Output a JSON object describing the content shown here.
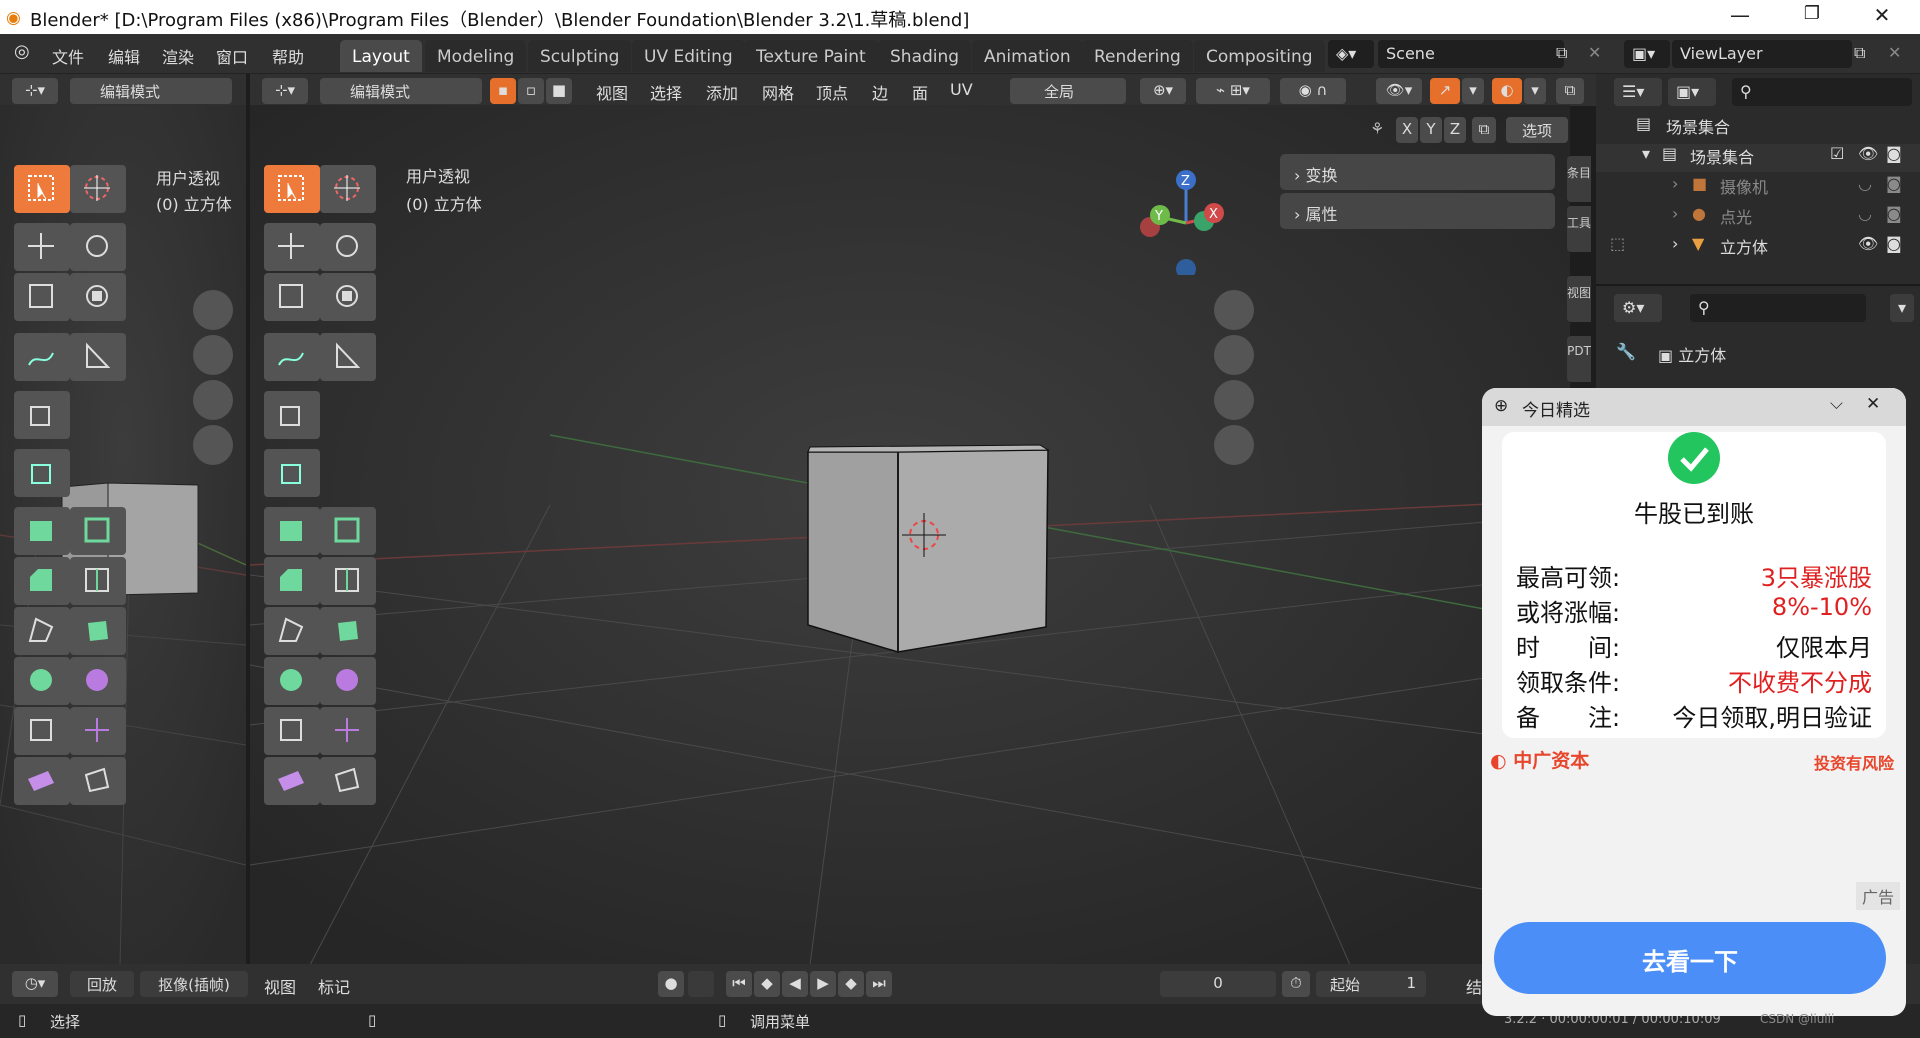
{
  "titlebar": {
    "title": "Blender* [D:\\Program Files (x86)\\Program Files（Blender）\\Blender Foundation\\Blender 3.2\\1.草稿.blend]",
    "minimize": "—",
    "restore": "❐",
    "close": "✕"
  },
  "menu": {
    "file": "文件",
    "edit": "编辑",
    "render": "渲染",
    "window": "窗口",
    "help": "帮助"
  },
  "workspace_tabs": [
    "Layout",
    "Modeling",
    "Sculpting",
    "UV Editing",
    "Texture Paint",
    "Shading",
    "Animation",
    "Rendering",
    "Compositing"
  ],
  "scene": {
    "name": "Scene",
    "viewlayer": "ViewLayer"
  },
  "left_view": {
    "mode": "编辑模式",
    "overlay_view": "用户透视",
    "overlay_obj": "(0) 立方体"
  },
  "main_view": {
    "mode": "编辑模式",
    "menus": [
      "视图",
      "选择",
      "添加",
      "网格",
      "顶点",
      "边",
      "面",
      "UV"
    ],
    "orientation": "全局",
    "options": "选项",
    "axes": [
      "X",
      "Y",
      "Z"
    ],
    "overlay_view": "用户透视",
    "overlay_obj": "(0) 立方体",
    "gizmo": {
      "z": "Z",
      "y": "Y",
      "x": "X"
    }
  },
  "n_panel": {
    "transform": "变换",
    "properties": "属性"
  },
  "side_tabs": [
    "条目",
    "工具",
    "视图",
    "PDT"
  ],
  "outliner": {
    "root": "场景集合",
    "collection": "场景集合",
    "items": [
      {
        "name": "摄像机"
      },
      {
        "name": "点光"
      },
      {
        "name": "立方体"
      }
    ]
  },
  "properties": {
    "object": "立方体"
  },
  "timeline": {
    "playback": "回放",
    "keying": "抠像(插帧)",
    "view": "视图",
    "marker": "标记",
    "frame": "0",
    "start_label": "起始",
    "start": "1",
    "end_label": "结"
  },
  "status": {
    "select": "选择",
    "menu": "调用菜单",
    "version": "3.2.2 · 00:00:00:01 / 00:00:10:09",
    "watermark": "CSDN @liulii"
  },
  "ad": {
    "header": "今日精选",
    "headline": "牛股已到账",
    "rows": [
      {
        "k": "最高可领:",
        "v": "3只暴涨股",
        "red": true
      },
      {
        "k": "或将涨幅:",
        "v": "8%-10%",
        "red": true
      },
      {
        "k": "时　　间:",
        "v": "仅限本月",
        "red": false
      },
      {
        "k": "领取条件:",
        "v": "不收费不分成",
        "red": true
      },
      {
        "k": "备　　注:",
        "v": "今日领取,明日验证",
        "red": false
      }
    ],
    "brand": "中广资本",
    "risk": "投资有风险",
    "ad_label": "广告",
    "cta": "去看一下"
  }
}
